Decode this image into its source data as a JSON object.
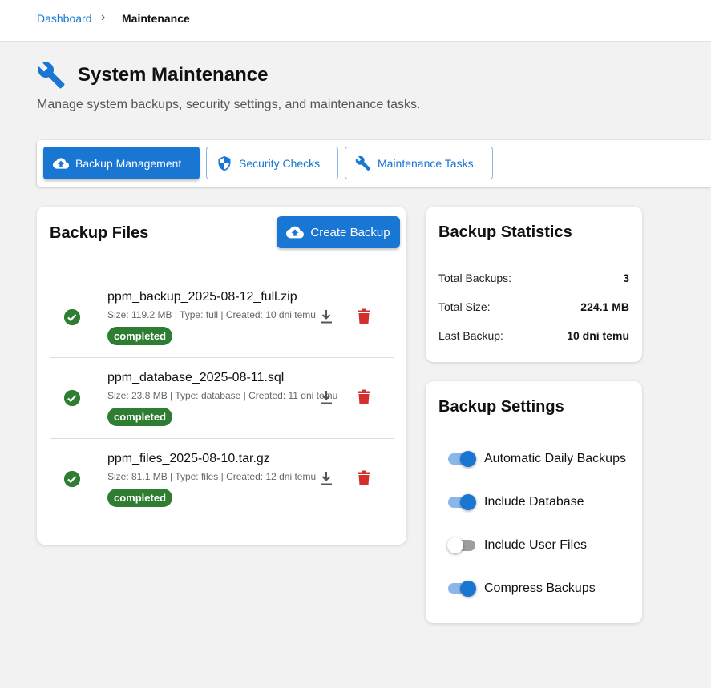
{
  "breadcrumb": {
    "parent": "Dashboard",
    "separator": "›",
    "current": "Maintenance"
  },
  "header": {
    "title": "System Maintenance",
    "subtitle": "Manage system backups, security settings, and maintenance tasks.",
    "icon": "wrench-icon"
  },
  "tabs": [
    {
      "label": "Backup Management",
      "icon": "cloud-upload-icon",
      "active": true
    },
    {
      "label": "Security Checks",
      "icon": "shield-icon",
      "active": false
    },
    {
      "label": "Maintenance Tasks",
      "icon": "wrench-icon",
      "active": false
    }
  ],
  "backup_files": {
    "title": "Backup Files",
    "create_label": "Create Backup",
    "items": [
      {
        "name": "ppm_backup_2025-08-12_full.zip",
        "meta": "Size: 119.2 MB | Type: full | Created: 10 dni temu",
        "status": "completed"
      },
      {
        "name": "ppm_database_2025-08-11.sql",
        "meta": "Size: 23.8 MB | Type: database | Created: 11 dni temu",
        "status": "completed"
      },
      {
        "name": "ppm_files_2025-08-10.tar.gz",
        "meta": "Size: 81.1 MB | Type: files | Created: 12 dni temu",
        "status": "completed"
      }
    ]
  },
  "statistics": {
    "title": "Backup Statistics",
    "rows": [
      {
        "label": "Total Backups:",
        "value": "3"
      },
      {
        "label": "Total Size:",
        "value": "224.1 MB"
      },
      {
        "label": "Last Backup:",
        "value": "10 dni temu"
      }
    ]
  },
  "settings": {
    "title": "Backup Settings",
    "toggles": [
      {
        "label": "Automatic Daily Backups",
        "on": true
      },
      {
        "label": "Include Database",
        "on": true
      },
      {
        "label": "Include User Files",
        "on": false
      },
      {
        "label": "Compress Backups",
        "on": true
      }
    ]
  },
  "colors": {
    "primary": "#1976d2",
    "success": "#2e7d32",
    "danger": "#d32f2f",
    "background": "#f2f2f2"
  }
}
